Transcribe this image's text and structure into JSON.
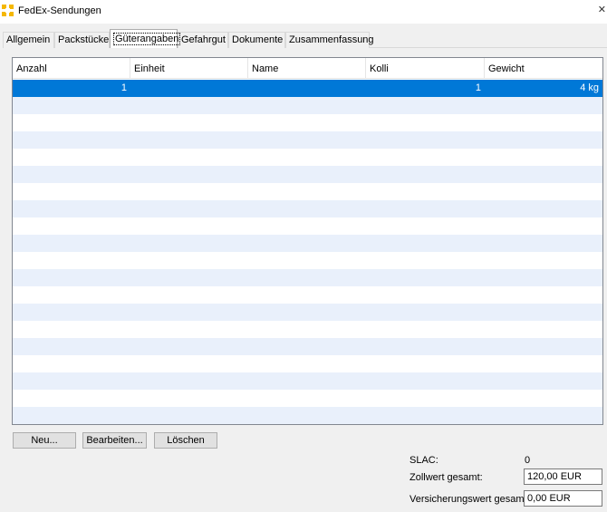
{
  "window": {
    "title": "FedEx-Sendungen",
    "close_glyph": "✕",
    "icon": "fedex-app-icon"
  },
  "tabs": [
    {
      "label": "Allgemein",
      "active": false
    },
    {
      "label": "Packstücke",
      "active": false
    },
    {
      "label": "Güterangaben",
      "active": true
    },
    {
      "label": "Gefahrgut",
      "active": false
    },
    {
      "label": "Dokumente",
      "active": false
    },
    {
      "label": "Zusammenfassung",
      "active": false
    }
  ],
  "table": {
    "columns": [
      "Anzahl",
      "Einheit",
      "Name",
      "Kolli",
      "Gewicht"
    ],
    "rows": [
      {
        "anzahl": "1",
        "einheit": "",
        "name": "",
        "kolli": "1",
        "gewicht": "4 kg",
        "selected": true
      }
    ],
    "colors": {
      "selection": "#0078d7",
      "alt_row": "#e9f0fb"
    }
  },
  "buttons": {
    "new": "Neu...",
    "edit": "Bearbeiten...",
    "delete": "Löschen"
  },
  "summary": {
    "slac_label": "SLAC:",
    "slac_value": "0",
    "customs_label": "Zollwert gesamt:",
    "customs_value": "120,00 EUR",
    "insurance_label": "Versicherungswert gesamt:",
    "insurance_value": "0,00 EUR"
  }
}
